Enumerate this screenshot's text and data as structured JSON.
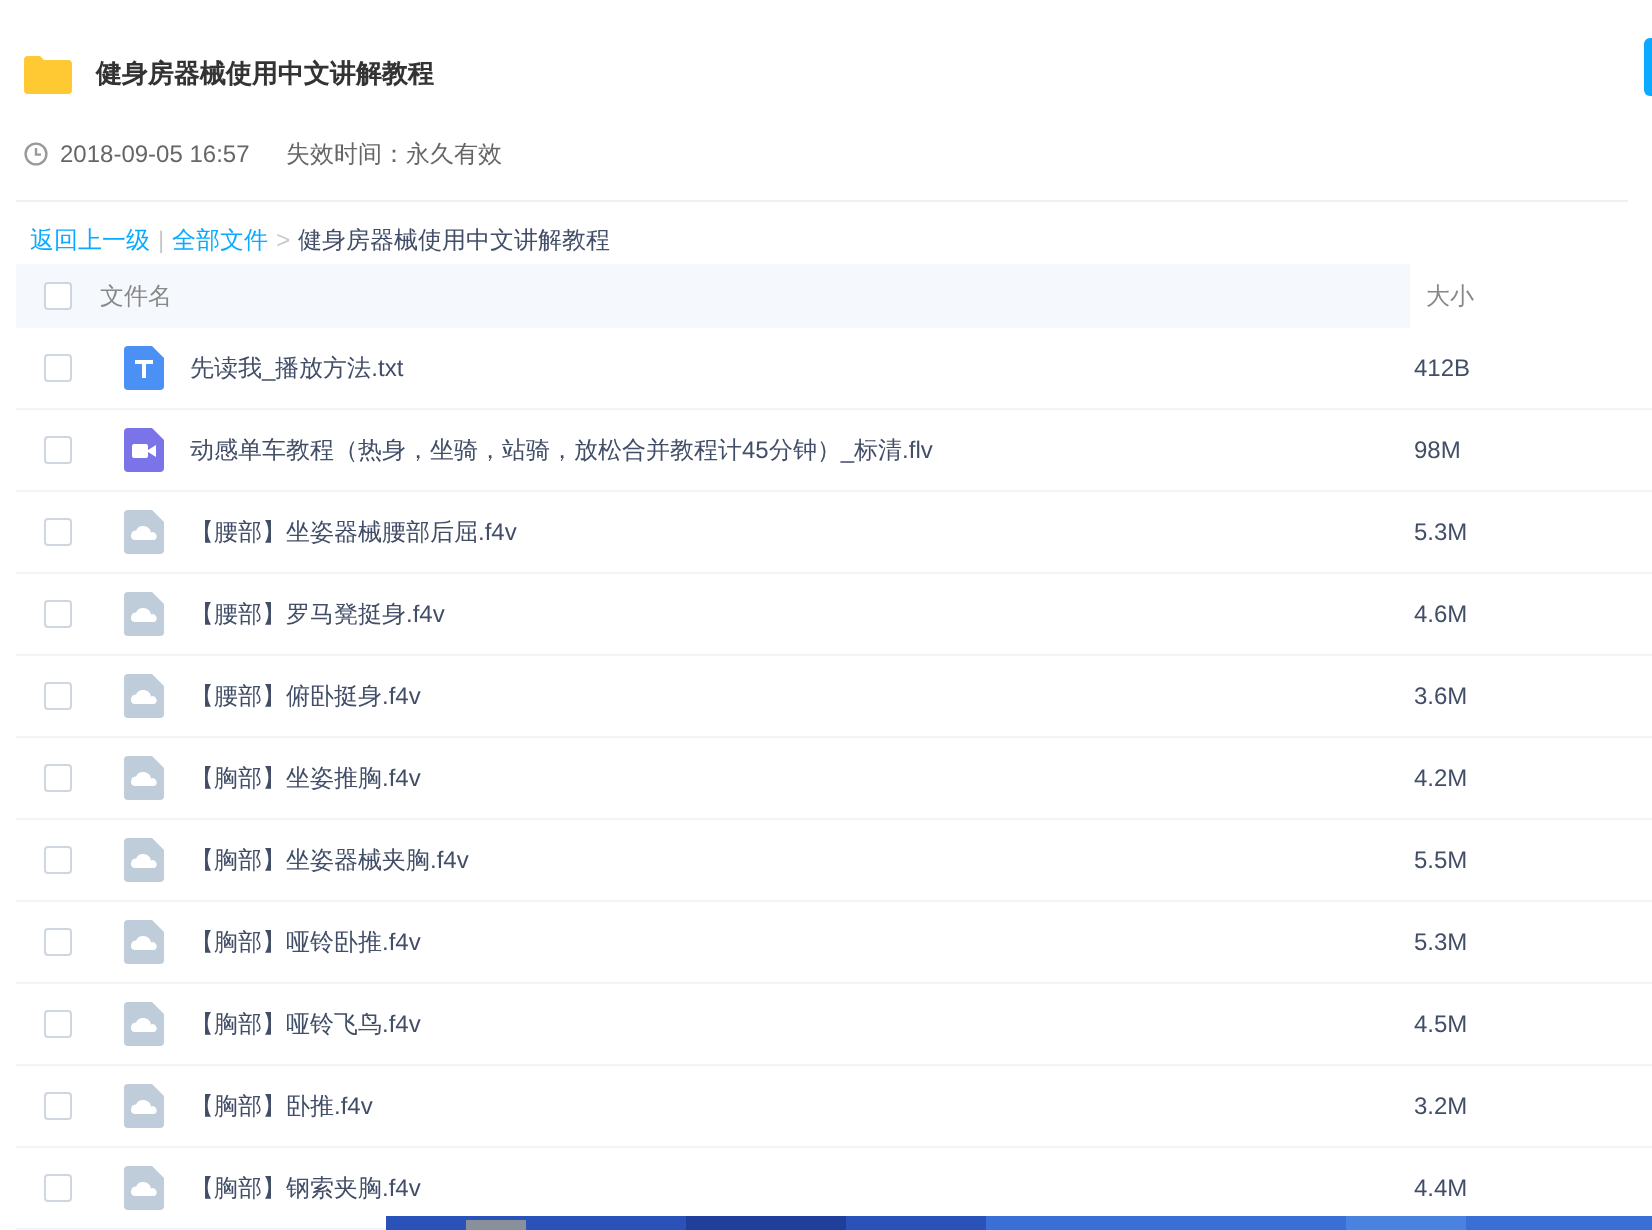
{
  "share": {
    "title": "健身房器械使用中文讲解教程",
    "date": "2018-09-05 16:57",
    "expiry": "失效时间：永久有效"
  },
  "breadcrumb": {
    "back": "返回上一级",
    "separator_1": "|",
    "root": "全部文件",
    "separator_2": ">",
    "current": "健身房器械使用中文讲解教程"
  },
  "table": {
    "select_all_checked": false,
    "columns": [
      "文件名",
      "大小"
    ],
    "rows": [
      {
        "kind": "text",
        "name": "先读我_播放方法.txt",
        "size": "412B",
        "checked": false
      },
      {
        "kind": "video",
        "name": "动感单车教程（热身，坐骑，站骑，放松合并教程计45分钟）_标清.flv",
        "size": "98M",
        "checked": false
      },
      {
        "kind": "file",
        "name": "【腰部】坐姿器械腰部后屈.f4v",
        "size": "5.3M",
        "checked": false
      },
      {
        "kind": "file",
        "name": "【腰部】罗马凳挺身.f4v",
        "size": "4.6M",
        "checked": false
      },
      {
        "kind": "file",
        "name": "【腰部】俯卧挺身.f4v",
        "size": "3.6M",
        "checked": false
      },
      {
        "kind": "file",
        "name": "【胸部】坐姿推胸.f4v",
        "size": "4.2M",
        "checked": false
      },
      {
        "kind": "file",
        "name": "【胸部】坐姿器械夹胸.f4v",
        "size": "5.5M",
        "checked": false
      },
      {
        "kind": "file",
        "name": "【胸部】哑铃卧推.f4v",
        "size": "5.3M",
        "checked": false
      },
      {
        "kind": "file",
        "name": "【胸部】哑铃飞鸟.f4v",
        "size": "4.5M",
        "checked": false
      },
      {
        "kind": "file",
        "name": "【胸部】卧推.f4v",
        "size": "3.2M",
        "checked": false
      },
      {
        "kind": "file",
        "name": "【胸部】钢索夹胸.f4v",
        "size": "4.4M",
        "checked": false
      }
    ]
  }
}
